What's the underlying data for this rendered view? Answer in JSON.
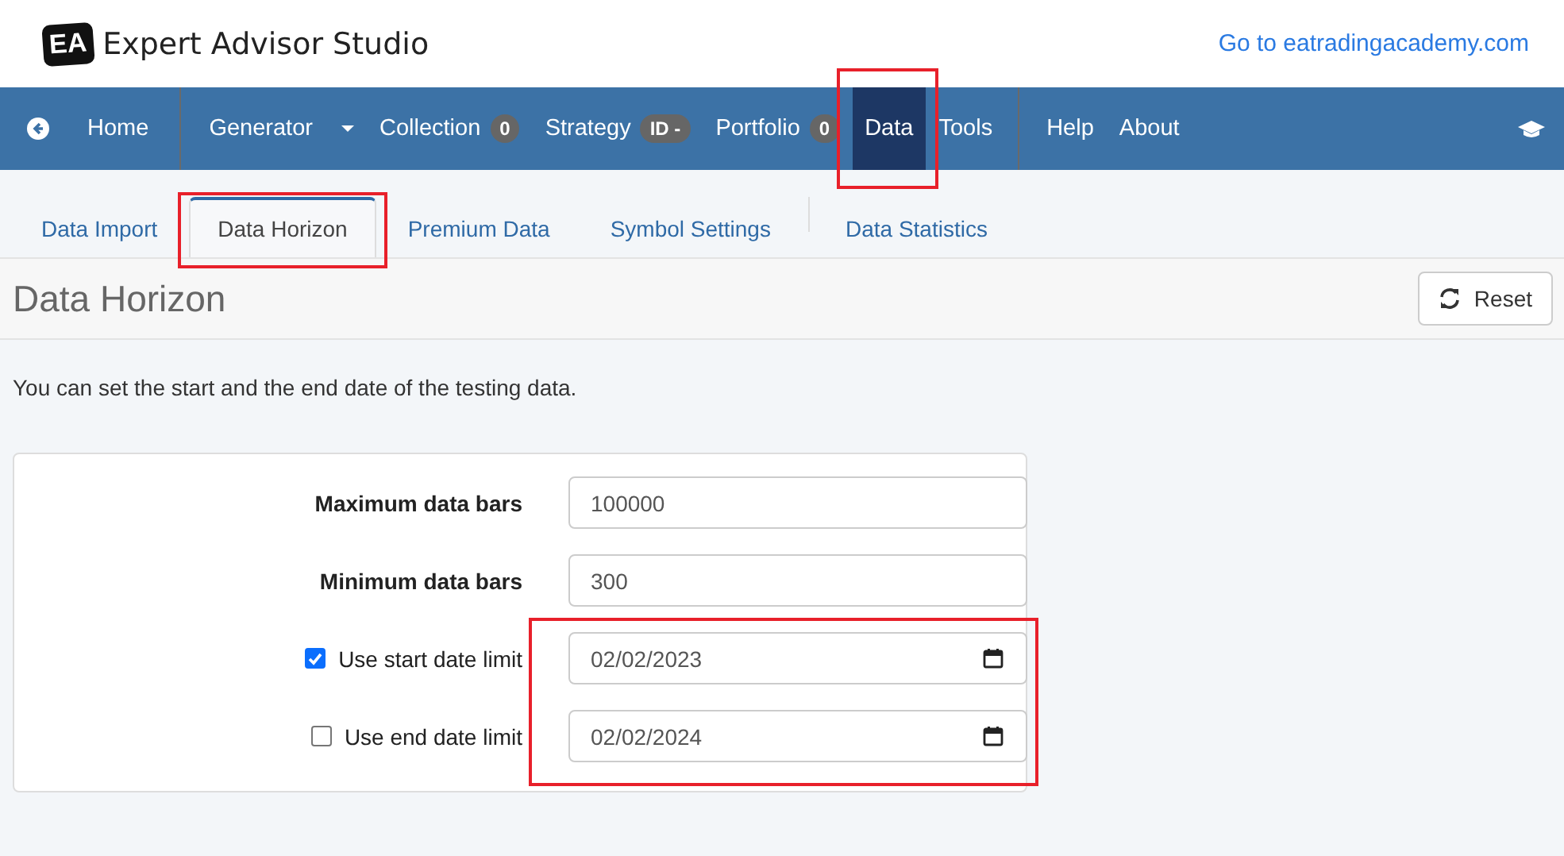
{
  "header": {
    "logo": "EA",
    "title": "Expert Advisor Studio",
    "link": "Go to eatradingacademy.com"
  },
  "nav": [
    {
      "kind": "back",
      "label": "Home",
      "selected": false,
      "highlighted": false
    },
    {
      "kind": "dropdown",
      "label": "Generator",
      "selected": false,
      "highlighted": false
    },
    {
      "kind": "badge",
      "label": "Collection",
      "badge": "0",
      "selected": false,
      "highlighted": false
    },
    {
      "kind": "badge",
      "label": "Strategy",
      "badge": "ID -",
      "selected": false,
      "highlighted": false
    },
    {
      "kind": "badge",
      "label": "Portfolio",
      "badge": "0",
      "selected": false,
      "highlighted": false
    },
    {
      "kind": "plain",
      "label": "Data",
      "selected": true,
      "highlighted": true
    },
    {
      "kind": "plain",
      "label": "Tools",
      "selected": false,
      "highlighted": false
    },
    {
      "kind": "divider-plain",
      "label": "Help",
      "selected": false,
      "highlighted": false
    },
    {
      "kind": "plain",
      "label": "About",
      "selected": false,
      "highlighted": false
    }
  ],
  "tabs": [
    {
      "label": "Data Import",
      "selected": false,
      "highlighted": false
    },
    {
      "label": "Data Horizon",
      "selected": true,
      "highlighted": true
    },
    {
      "label": "Premium Data",
      "selected": false,
      "highlighted": false
    },
    {
      "label": "Symbol Settings",
      "selected": false,
      "highlighted": false
    },
    {
      "label": "Data Statistics",
      "selected": false,
      "highlighted": false
    }
  ],
  "page": {
    "title": "Data Horizon",
    "reset": "Reset",
    "intro": "You can set the start and the end date of the testing data."
  },
  "fields": [
    {
      "kind": "number",
      "label": "Maximum data bars",
      "value": "100000"
    },
    {
      "kind": "number",
      "label": "Minimum data bars",
      "value": "300"
    },
    {
      "kind": "date",
      "label": "Use start date limit",
      "checked": true,
      "value": "02/02/2023"
    },
    {
      "kind": "date",
      "label": "Use end date limit",
      "checked": false,
      "value": "02/02/2024"
    }
  ],
  "date_fields_highlighted": true
}
